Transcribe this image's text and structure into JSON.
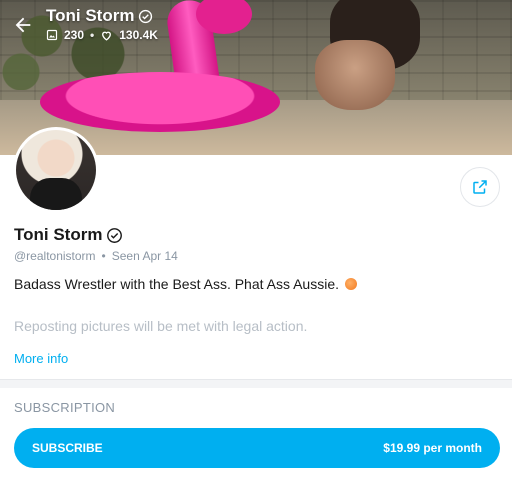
{
  "header": {
    "title": "Toni Storm",
    "media_count": "230",
    "likes_count": "130.4K"
  },
  "profile": {
    "name": "Toni Storm",
    "handle": "@realtonistorm",
    "separator": "•",
    "seen": "Seen  Apr 14",
    "bio": "Badass Wrestler with the Best Ass. Phat Ass Aussie.",
    "notice": "Reposting pictures will be met with legal action.",
    "more_info": "More info"
  },
  "subscription": {
    "section_title": "SUBSCRIPTION",
    "button_label": "SUBSCRIBE",
    "price": "$19.99 per month"
  },
  "colors": {
    "accent": "#00aff0",
    "muted": "#8a96a3"
  },
  "icons": [
    "back-arrow-icon",
    "verified-icon",
    "image-icon",
    "heart-icon",
    "share-icon",
    "peach-emoji-icon"
  ]
}
